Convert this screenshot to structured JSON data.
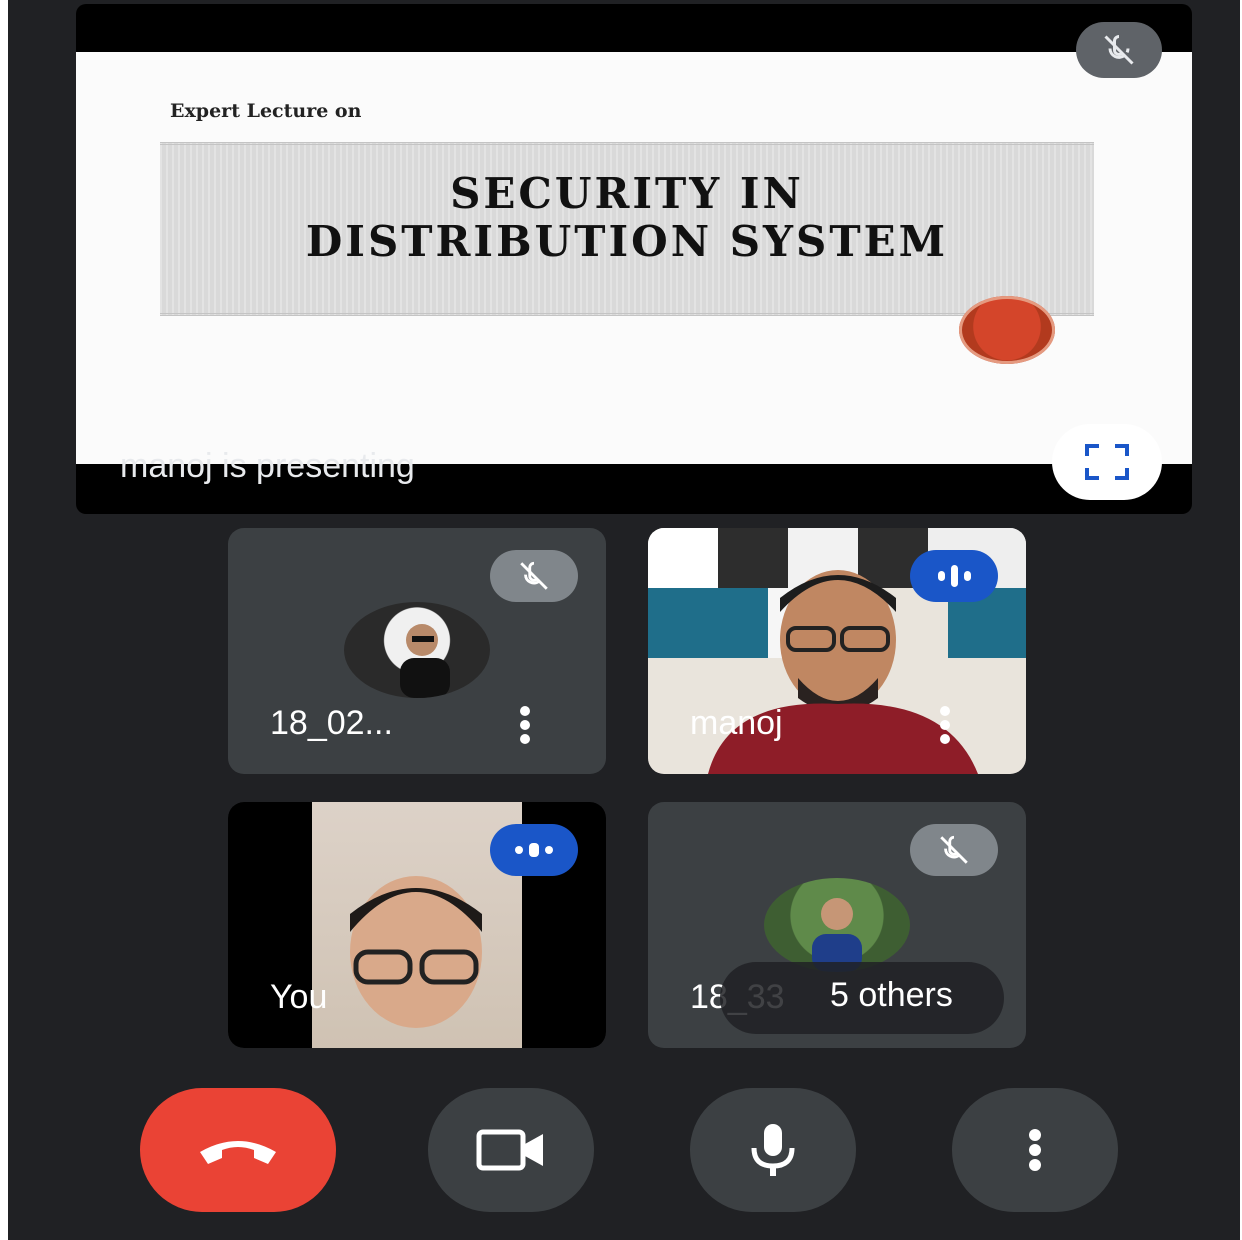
{
  "presentation": {
    "slide_kicker": "Expert Lecture on",
    "slide_title_line1": "SECURITY IN",
    "slide_title_line2": "DISTRIBUTION SYSTEM",
    "presenting_text": "manoj is presenting"
  },
  "tiles": [
    {
      "name": "18_02...",
      "status": "muted"
    },
    {
      "name": "manoj",
      "status": "speaking"
    },
    {
      "name": "You",
      "status": "speaking"
    },
    {
      "name": "18_33",
      "others_label": "5 others",
      "status": "muted"
    }
  ],
  "colors": {
    "background": "#202124",
    "tile": "#3c4043",
    "end_call": "#ea4335",
    "speaking_badge": "#1a56c8",
    "muted_badge": "#80868b"
  },
  "controls": {
    "end_call_icon": "phone-hangup-icon",
    "camera_icon": "videocam-icon",
    "mic_icon": "mic-icon",
    "more_icon": "more-vert-icon"
  }
}
